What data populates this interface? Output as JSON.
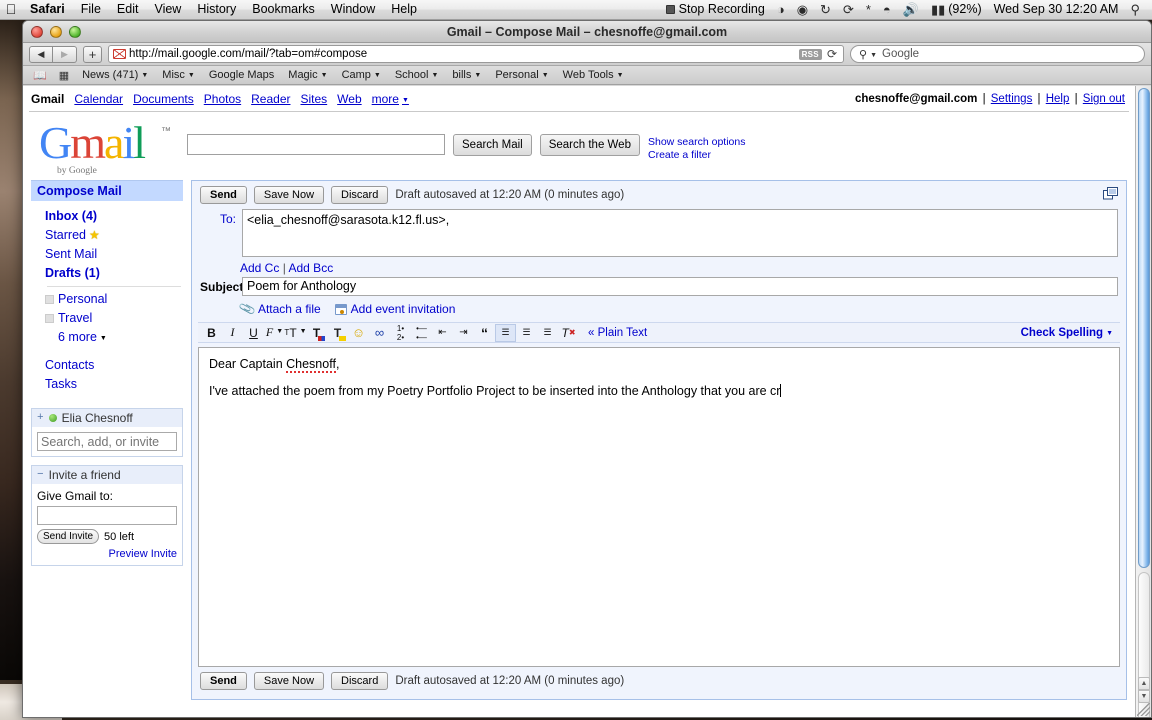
{
  "menubar": {
    "apple": "apple-logo",
    "items": [
      "Safari",
      "File",
      "Edit",
      "View",
      "History",
      "Bookmarks",
      "Window",
      "Help"
    ],
    "status": {
      "recording": "Stop Recording",
      "battery": "(92%)",
      "datetime": "Wed Sep 30  12:20 AM"
    }
  },
  "window": {
    "title": "Gmail – Compose Mail – chesnoffe@gmail.com",
    "url": "http://mail.google.com/mail/?tab=om#compose",
    "rss": "RSS",
    "search_placeholder": "Google"
  },
  "bookmarks": [
    {
      "label": "News (471)",
      "menu": true
    },
    {
      "label": "Misc",
      "menu": true
    },
    {
      "label": "Google Maps",
      "menu": false
    },
    {
      "label": "Magic",
      "menu": true
    },
    {
      "label": "Camp",
      "menu": true
    },
    {
      "label": "School",
      "menu": true
    },
    {
      "label": "bills",
      "menu": true
    },
    {
      "label": "Personal",
      "menu": true
    },
    {
      "label": "Web Tools",
      "menu": true
    }
  ],
  "gnav": {
    "links": [
      "Gmail",
      "Calendar",
      "Documents",
      "Photos",
      "Reader",
      "Sites",
      "Web",
      "more"
    ],
    "account": "chesnoffe@gmail.com",
    "settings": "Settings",
    "help": "Help",
    "signout": "Sign out"
  },
  "logo": {
    "letters": [
      "G",
      "m",
      "a",
      "i",
      "l"
    ],
    "tm": "™",
    "by": "by Google"
  },
  "search": {
    "value": "",
    "search_mail": "Search Mail",
    "search_web": "Search the Web",
    "show_options": "Show search options",
    "create_filter": "Create a filter"
  },
  "sidebar": {
    "compose": "Compose Mail",
    "folders": [
      {
        "label": "Inbox (4)",
        "bold": true
      },
      {
        "label": "Starred",
        "bold": false,
        "star": true
      },
      {
        "label": "Sent Mail",
        "bold": false
      },
      {
        "label": "Drafts (1)",
        "bold": true
      }
    ],
    "labels": [
      {
        "label": "Personal"
      },
      {
        "label": "Travel"
      }
    ],
    "more": "6 more",
    "extra": [
      "Contacts",
      "Tasks"
    ],
    "chat": {
      "twisty": "+",
      "name": "Elia Chesnoff",
      "status": "online",
      "search_placeholder": "Search, add, or invite"
    },
    "invite": {
      "twisty": "−",
      "title": "Invite a friend",
      "prompt": "Give Gmail to:",
      "value": "",
      "button": "Send Invite",
      "left": "50 left",
      "preview": "Preview Invite"
    }
  },
  "compose": {
    "send": "Send",
    "save_now": "Save Now",
    "discard": "Discard",
    "autosave": "Draft autosaved at 12:20 AM (0 minutes ago)",
    "popout_icon": "pop-out-window-icon",
    "to_label": "To:",
    "to_value": "<elia_chesnoff@sarasota.k12.fl.us>,",
    "add_cc": "Add Cc",
    "cc_sep": "|",
    "add_bcc": "Add Bcc",
    "subject_label": "Subject:",
    "subject_value": "Poem for Anthology",
    "attach_file": "Attach a file",
    "add_event": "Add event invitation",
    "toolbar": [
      {
        "name": "bold-icon",
        "glyph": "B",
        "style": "bold"
      },
      {
        "name": "italic-icon",
        "glyph": "I",
        "style": "italic"
      },
      {
        "name": "underline-icon",
        "glyph": "U",
        "style": "underline"
      },
      {
        "name": "font-family-icon",
        "glyph": "ℱ",
        "style": "menu"
      },
      {
        "name": "font-size-icon",
        "glyph": "ᴛᴛ",
        "style": "menu"
      },
      {
        "name": "text-color-icon",
        "glyph": "T",
        "style": "color"
      },
      {
        "name": "highlight-color-icon",
        "glyph": "T",
        "style": "highlight"
      },
      {
        "name": "insert-emoticon-icon",
        "glyph": "☺",
        "style": "emoji"
      },
      {
        "name": "insert-link-icon",
        "glyph": "⚭",
        "style": "link"
      },
      {
        "name": "numbered-list-icon",
        "glyph": "≡",
        "style": "list-num"
      },
      {
        "name": "bulleted-list-icon",
        "glyph": "≡",
        "style": "list-bullet"
      },
      {
        "name": "outdent-icon",
        "glyph": "≡",
        "style": "outdent"
      },
      {
        "name": "indent-icon",
        "glyph": "≡",
        "style": "indent"
      },
      {
        "name": "quote-icon",
        "glyph": "“",
        "style": "quote"
      },
      {
        "name": "align-left-icon",
        "glyph": "≡",
        "style": "align-left",
        "selected": true
      },
      {
        "name": "align-center-icon",
        "glyph": "≡",
        "style": "align-center"
      },
      {
        "name": "align-right-icon",
        "glyph": "≡",
        "style": "align-right"
      },
      {
        "name": "remove-formatting-icon",
        "glyph": "T",
        "style": "clear"
      }
    ],
    "plain_text": "« Plain Text",
    "check_spelling": "Check Spelling",
    "body": {
      "line1_pre": "Dear Captain ",
      "line1_misspelled": "Chesnoff",
      "line1_post": ",",
      "line2": "I've attached the poem from my Poetry Portfolio Project to be inserted into the Anthology that you are cr"
    }
  }
}
